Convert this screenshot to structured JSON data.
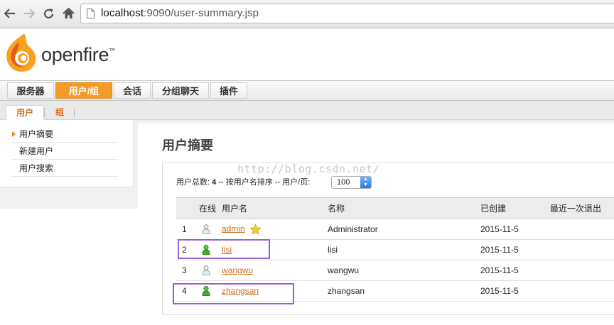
{
  "browser": {
    "url_host": "localhost",
    "url_rest": ":9090/user-summary.jsp"
  },
  "header": {
    "brand": "openfire",
    "brand_tm": "™"
  },
  "main_tabs": [
    {
      "label": "服务器",
      "active": false
    },
    {
      "label": "用户/组",
      "active": true
    },
    {
      "label": "会话",
      "active": false
    },
    {
      "label": "分组聊天",
      "active": false
    },
    {
      "label": "插件",
      "active": false
    }
  ],
  "sub_tabs": [
    {
      "label": "用户",
      "active": true
    },
    {
      "label": "组",
      "active": false
    }
  ],
  "sidebar": {
    "items": [
      {
        "label": "用户摘要",
        "selected": true
      },
      {
        "label": "新建用户",
        "selected": false
      },
      {
        "label": "用户搜索",
        "selected": false
      }
    ]
  },
  "main": {
    "title": "用户摘要",
    "watermark": "http://blog.csdn.net/",
    "summary_prefix": "用户总数:",
    "total_users": "4",
    "summary_suffix": "-- 按用户名排序 -- 用户/页:",
    "per_page": "100",
    "table": {
      "headers": [
        "",
        "在线",
        "用户名",
        "名称",
        "已创建",
        "最近一次退出"
      ],
      "rows": [
        {
          "num": "1",
          "online": false,
          "username": "admin",
          "admin": true,
          "name": "Administrator",
          "created": "2015-11-5",
          "last_logout": ""
        },
        {
          "num": "2",
          "online": true,
          "username": "lisi",
          "admin": false,
          "name": "lisi",
          "created": "2015-11-5",
          "last_logout": ""
        },
        {
          "num": "3",
          "online": false,
          "username": "wangwu",
          "admin": false,
          "name": "wangwu",
          "created": "2015-11-5",
          "last_logout": ""
        },
        {
          "num": "4",
          "online": true,
          "username": "zhangsan",
          "admin": false,
          "name": "zhangsan",
          "created": "2015-11-5",
          "last_logout": ""
        }
      ]
    }
  },
  "colors": {
    "accent_orange": "#f29c27",
    "link_orange": "#d36d18",
    "online_green": "#3fae2a",
    "offline_gray": "#b9c6c6",
    "highlight_purple": "#9a5fd6"
  }
}
